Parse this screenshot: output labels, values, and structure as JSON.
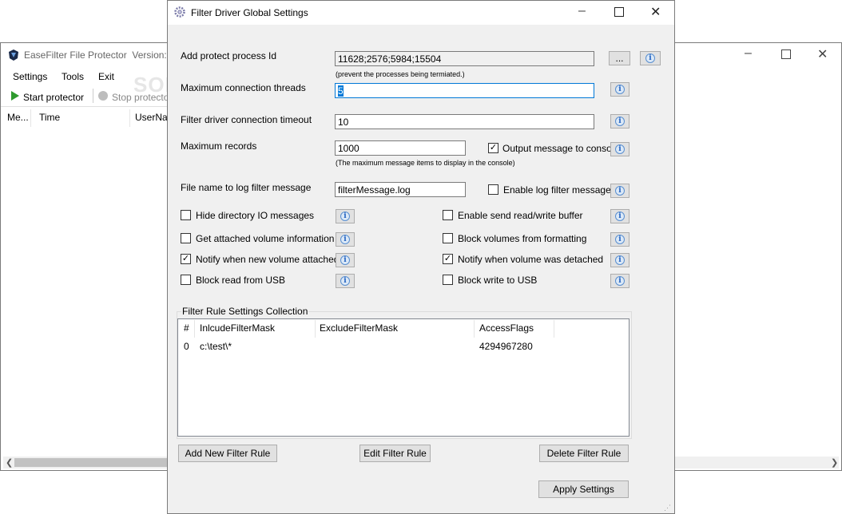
{
  "main_window": {
    "title": "EaseFilter File Protector",
    "version_label": "Version:",
    "menu": [
      "Settings",
      "Tools",
      "Exit"
    ],
    "toolbar": {
      "start": "Start protector",
      "stop": "Stop protecto"
    },
    "columns": [
      "Me...",
      "Time",
      "UserNam"
    ],
    "watermark": "SOFTPEDIA"
  },
  "dialog": {
    "title": "Filter Driver Global Settings",
    "fields": {
      "protect_pid_label": "Add protect process Id",
      "protect_pid_value": "11628;2576;5984;15504",
      "protect_pid_hint": "(prevent the processes being termiated.)",
      "browse_label": "...",
      "max_threads_label": "Maximum connection threads",
      "max_threads_value": "5",
      "timeout_label": "Filter driver connection timeout",
      "timeout_value": "10",
      "max_records_label": "Maximum records",
      "max_records_value": "1000",
      "max_records_hint": "(The maximum message items to display in the console)",
      "output_console_label": "Output message to console",
      "log_file_label": "File name to log filter message",
      "log_file_value": "filterMessage.log",
      "enable_log_label": "Enable log filter message"
    },
    "options": {
      "hide_dir_io": "Hide directory IO messages",
      "send_rw_buffer": "Enable send read/write buffer",
      "get_volume_info": "Get attached volume information",
      "block_format": "Block volumes from formatting",
      "notify_attached": "Notify when new volume attached",
      "notify_detached": "Notify when volume was detached",
      "block_read_usb": "Block read from USB",
      "block_write_usb": "Block write to USB"
    },
    "rules": {
      "group_title": "Filter Rule Settings Collection",
      "columns": [
        "#",
        "InlcudeFilterMask",
        "ExcludeFilterMask",
        "AccessFlags"
      ],
      "rows": [
        {
          "index": "0",
          "include": "c:\\test\\*",
          "exclude": "",
          "flags": "4294967280"
        }
      ]
    },
    "buttons": {
      "add": "Add New Filter Rule",
      "edit": "Edit Filter Rule",
      "delete": "Delete Filter Rule",
      "apply": "Apply Settings"
    }
  },
  "colors": {
    "dialog_bg": "#f0f0f0",
    "accent": "#0078d7"
  }
}
